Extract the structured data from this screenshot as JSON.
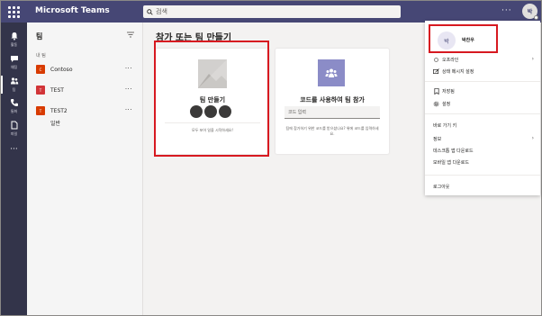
{
  "titlebar": {
    "app_title": "Microsoft Teams",
    "search_placeholder": "검색",
    "more_label": "···",
    "avatar_initial": "박"
  },
  "appbar": {
    "items": [
      {
        "label": "활동",
        "icon": "bell-icon"
      },
      {
        "label": "채팅",
        "icon": "chat-icon"
      },
      {
        "label": "팀",
        "icon": "teams-icon"
      },
      {
        "label": "통화",
        "icon": "phone-icon"
      },
      {
        "label": "파일",
        "icon": "file-icon"
      },
      {
        "label": "···",
        "icon": "more-apps-icon"
      }
    ]
  },
  "teams_panel": {
    "title": "팀",
    "section_label": "내 팀",
    "teams": [
      {
        "initial": "C",
        "name": "Contoso",
        "more": "···"
      },
      {
        "initial": "T",
        "name": "TEST",
        "more": "···"
      },
      {
        "initial": "T",
        "name": "TEST2",
        "more": "···"
      }
    ],
    "channel": "일반"
  },
  "main": {
    "title": "참가 또는 팀 만들기",
    "create_card": {
      "title": "팀 만들기",
      "description": "모두 포어 일을 시작하세요!"
    },
    "join_card": {
      "title": "코드를 사용하여 팀 참가",
      "code_placeholder": "코드 입력",
      "description": "팀에 참가하기 위한 코드를 받으셨나요? 위에 코드를 입력하세요."
    }
  },
  "dropdown": {
    "avatar_initial": "박",
    "user_name": "박찬우",
    "status": "오프라인",
    "status_message": "상태 메시지 설정",
    "saved": "저장됨",
    "settings": "설정",
    "shortcuts": "바로 가기 키",
    "about": "정보",
    "desktop_download": "데스크톱 앱 다운로드",
    "mobile_download": "모바일 앱 다운로드",
    "logout": "로그아웃",
    "chevron": "›"
  },
  "colors": {
    "titlebar": "#464775",
    "appbar": "#33344a",
    "highlight": "#d71920"
  }
}
